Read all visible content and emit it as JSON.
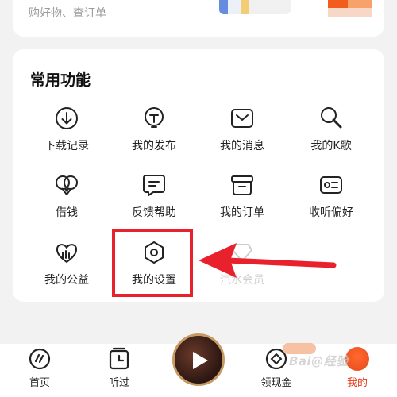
{
  "top_card": {
    "subtitle": "购好物、查订单"
  },
  "functions": {
    "title": "常用功能",
    "items": [
      {
        "label": "下载记录",
        "icon": "download-icon"
      },
      {
        "label": "我的发布",
        "icon": "lightbulb-icon"
      },
      {
        "label": "我的消息",
        "icon": "message-envelope-icon"
      },
      {
        "label": "我的K歌",
        "icon": "karaoke-mic-icon"
      },
      {
        "label": "借钱",
        "icon": "loan-icon"
      },
      {
        "label": "反馈帮助",
        "icon": "feedback-icon"
      },
      {
        "label": "我的订单",
        "icon": "order-box-icon"
      },
      {
        "label": "收听偏好",
        "icon": "preference-card-icon"
      },
      {
        "label": "我的公益",
        "icon": "charity-heart-icon"
      },
      {
        "label": "我的设置",
        "icon": "settings-hexagon-icon"
      },
      {
        "label": "汽水会员",
        "icon": "membership-icon"
      }
    ]
  },
  "bottom_nav": {
    "items": [
      {
        "label": "首页",
        "icon": "home-icon"
      },
      {
        "label": "听过",
        "icon": "history-icon"
      },
      {
        "label": "领现金",
        "icon": "cash-coin-icon"
      },
      {
        "label": "我的",
        "icon": "avatar-icon"
      }
    ]
  },
  "watermark": "Bai@经验",
  "colors": {
    "accent": "#e83a1c",
    "highlight": "#e8212c"
  }
}
